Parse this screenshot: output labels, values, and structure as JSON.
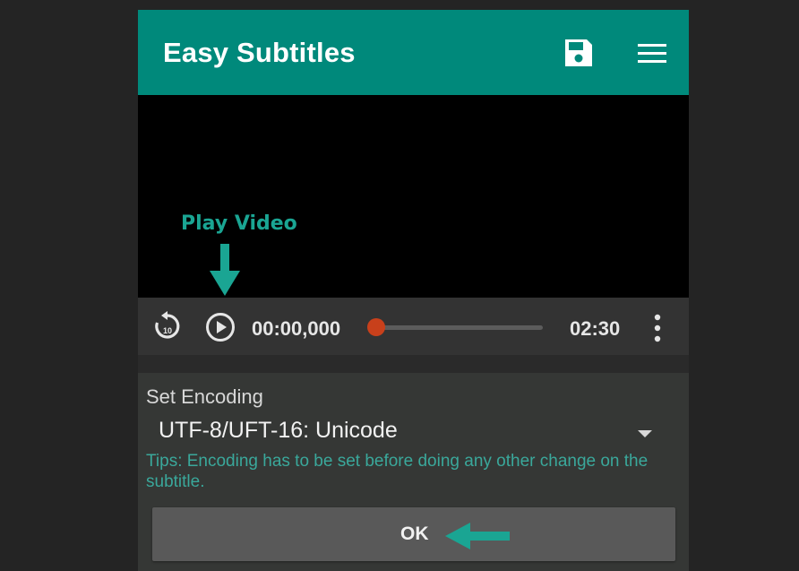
{
  "app": {
    "title": "Easy Subtitles",
    "accent_color": "#00897b"
  },
  "toolbar": {
    "save_icon": "floppy-disk-icon",
    "menu_icon": "hamburger-menu-icon"
  },
  "annotation": {
    "play_video_text": "Play Video",
    "color": "#1aa593"
  },
  "player": {
    "rewind_icon": "replay-10-icon",
    "rewind_seconds": "10",
    "play_icon": "play-circle-icon",
    "current_time": "00:00,000",
    "total_time": "02:30",
    "progress": 0,
    "seek_color": "#c8401b",
    "more_icon": "more-vertical-icon"
  },
  "dialog": {
    "label": "Set Encoding",
    "selected_encoding": "UTF-8/UFT-16: Unicode",
    "tips": "Tips: Encoding has to be set before doing any other change on the subtitle.",
    "ok_label": "OK",
    "tips_color": "#3aa89b"
  }
}
